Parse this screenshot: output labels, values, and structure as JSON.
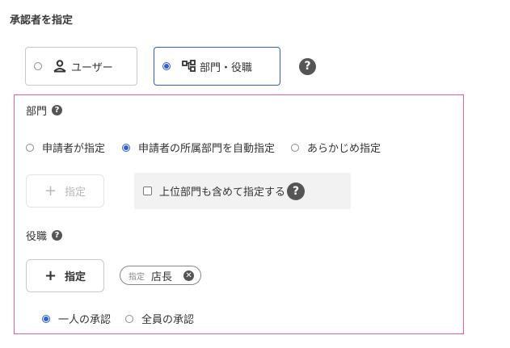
{
  "title": "承認者を指定",
  "type_options": {
    "user_label": "ユーザー",
    "dept_label": "部門・役職",
    "help": "?"
  },
  "department": {
    "label": "部門",
    "help": "?",
    "options": [
      "申請者が指定",
      "申請者の所属部門を自動指定",
      "あらかじめ指定"
    ],
    "selected_index": 1,
    "assign_button": "指定",
    "include_upper_label": "上位部門も含めて指定する",
    "include_upper_checked": false,
    "include_upper_help": "?"
  },
  "position": {
    "label": "役職",
    "help": "?",
    "assign_button": "指定",
    "chip_tag": "指定",
    "chip_value": "店長",
    "approval_options": [
      "一人の承認",
      "全員の承認"
    ],
    "approval_selected_index": 0
  },
  "colors": {
    "accent": "#2f5fd0",
    "panel_border": "#e8668a"
  }
}
